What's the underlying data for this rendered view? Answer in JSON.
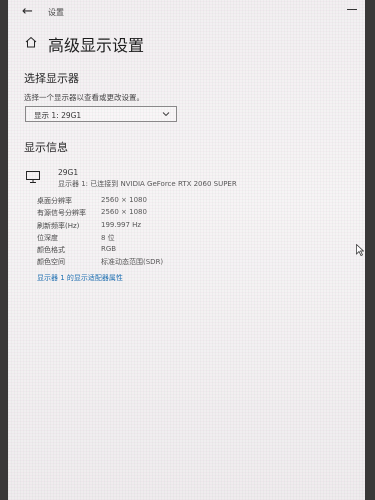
{
  "window": {
    "back_glyph": "←",
    "app_title": "设置"
  },
  "page": {
    "title": "高级显示设置"
  },
  "select_section": {
    "title": "选择显示器",
    "instruction": "选择一个显示器以查看或更改设置。",
    "dropdown_value": "显示 1: 29G1"
  },
  "info_section": {
    "title": "显示信息",
    "monitor_name": "29G1",
    "monitor_desc": "显示器 1: 已连接到 NVIDIA GeForce RTX 2060 SUPER",
    "rows": [
      {
        "label": "桌面分辨率",
        "value": "2560 × 1080"
      },
      {
        "label": "有源信号分辨率",
        "value": "2560 × 1080"
      },
      {
        "label": "刷新频率(Hz)",
        "value": "199.997 Hz"
      },
      {
        "label": "位深度",
        "value": "8 位"
      },
      {
        "label": "颜色格式",
        "value": "RGB"
      },
      {
        "label": "颜色空间",
        "value": "标准动态范围(SDR)"
      }
    ],
    "adapter_link": "显示器 1 的显示适配器属性"
  },
  "icons": {
    "back": "back-arrow-icon",
    "home": "home-icon",
    "dropdown": "chevron-down-icon",
    "monitor": "monitor-icon",
    "cursor": "mouse-cursor-icon"
  },
  "colors": {
    "link": "#1a6fb3",
    "background": "#f4f1f3"
  }
}
